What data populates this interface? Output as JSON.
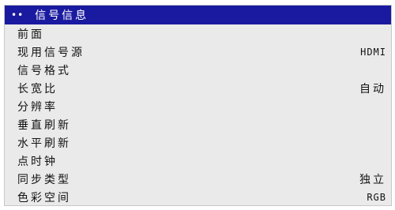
{
  "title": {
    "dots": "••",
    "text": "信号信息"
  },
  "items": [
    {
      "label": "前面",
      "value": ""
    },
    {
      "label": "现用信号源",
      "value": "HDMI"
    },
    {
      "label": "信号格式",
      "value": ""
    },
    {
      "label": "长宽比",
      "value": "自动"
    },
    {
      "label": "分辨率",
      "value": ""
    },
    {
      "label": "垂直刷新",
      "value": ""
    },
    {
      "label": "水平刷新",
      "value": ""
    },
    {
      "label": "点时钟",
      "value": ""
    },
    {
      "label": "同步类型",
      "value": "独立"
    },
    {
      "label": "色彩空间",
      "value": "RGB"
    }
  ],
  "colors": {
    "titlebar": "#1a1aa0",
    "panel": "#eaeaea"
  }
}
